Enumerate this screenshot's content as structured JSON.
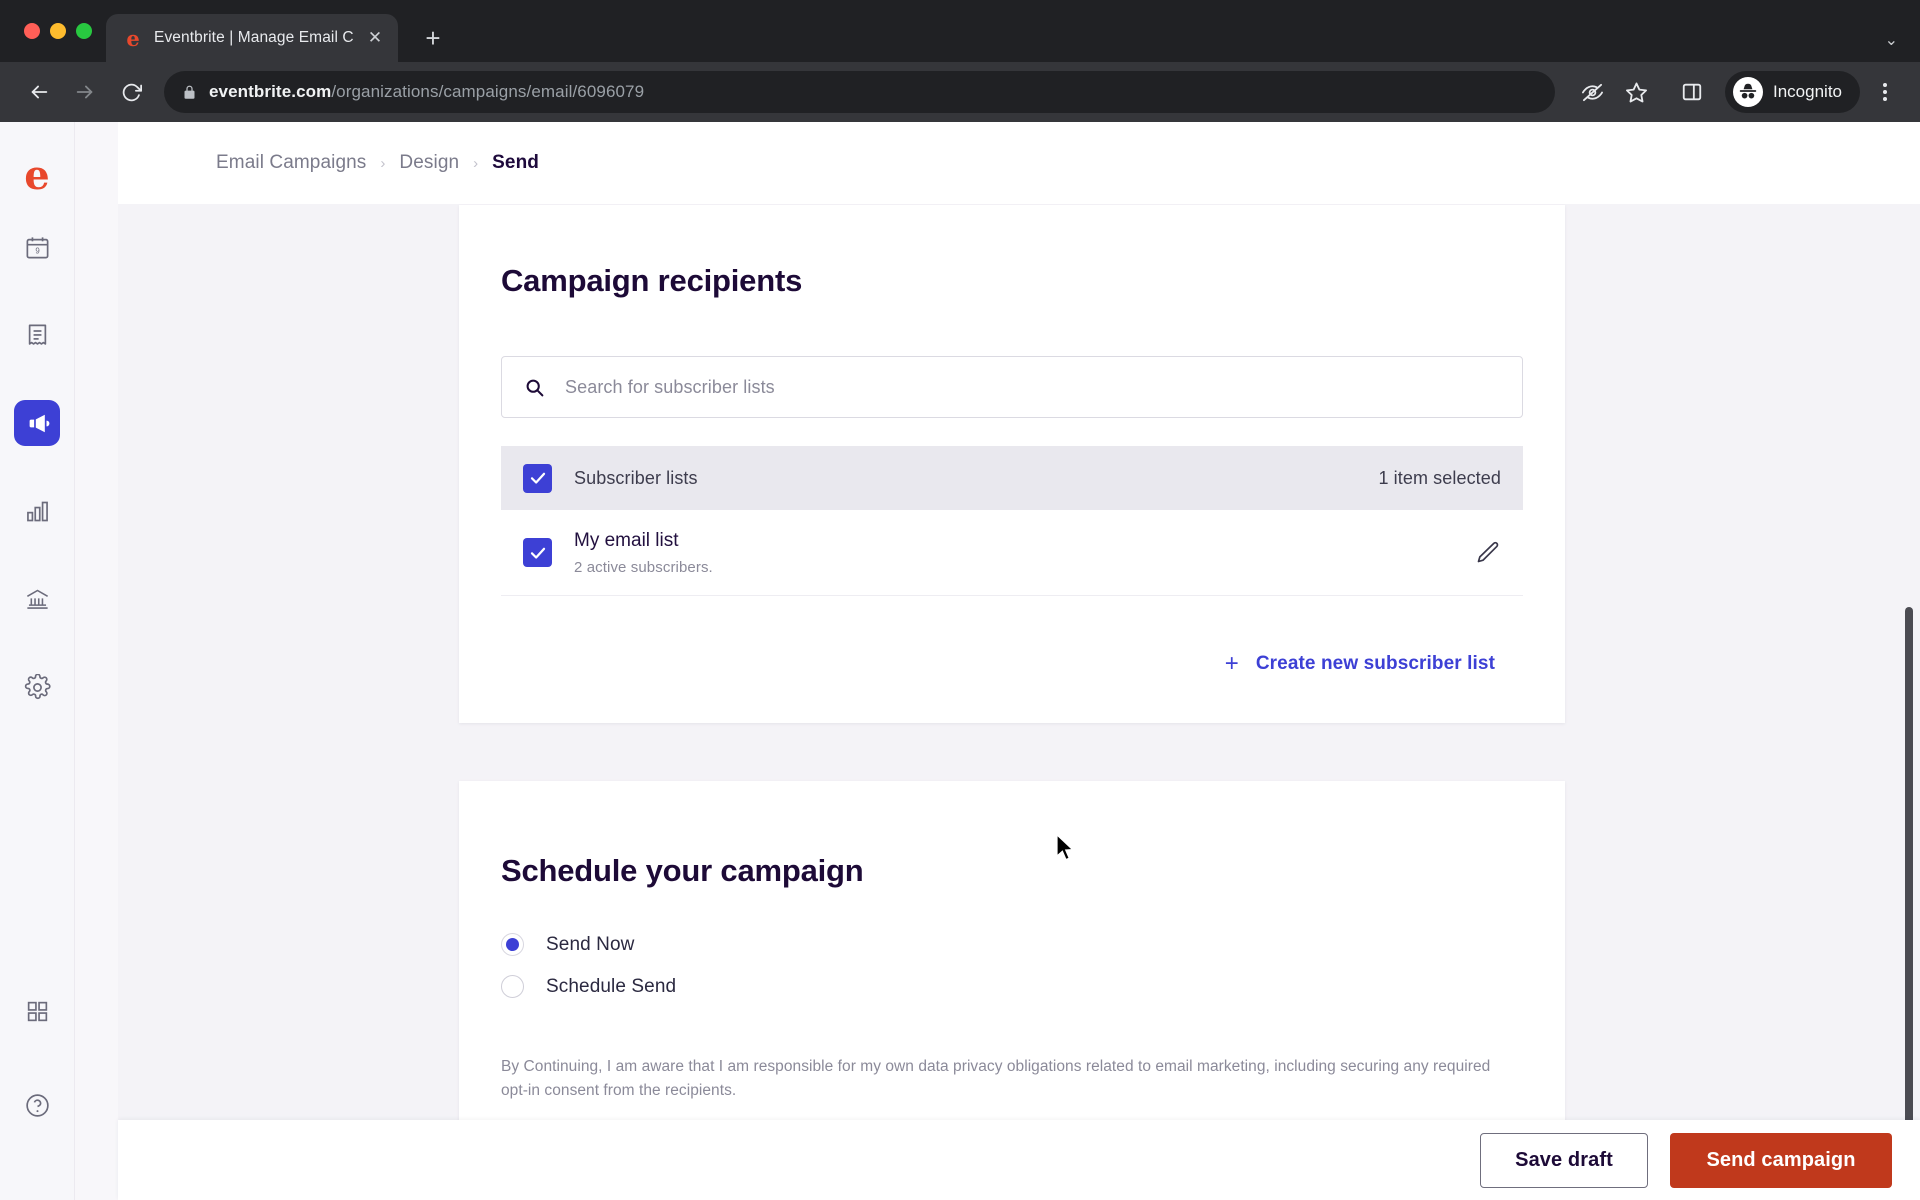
{
  "browser": {
    "tab": {
      "title": "Eventbrite | Manage Email Cam",
      "favicon_letter": "e",
      "close_label": "✕"
    },
    "new_tab_label": "+",
    "tabstrip_overflow_label": "⌄",
    "address": {
      "domain": "eventbrite.com",
      "path": "/organizations/campaigns/email/6096079",
      "lock_icon": "lock-icon"
    },
    "profile": {
      "label": "Incognito"
    },
    "toolbar_icons": [
      "back-icon",
      "forward-icon",
      "reload-icon",
      "tracking-protection-icon",
      "bookmark-star-icon",
      "side-panel-icon",
      "menu-kebab-icon"
    ]
  },
  "rail": {
    "logo_letter": "e",
    "items": [
      {
        "name": "events",
        "icon": "calendar-icon",
        "active": false
      },
      {
        "name": "orders",
        "icon": "receipt-icon",
        "active": false
      },
      {
        "name": "marketing",
        "icon": "megaphone-icon",
        "active": true
      },
      {
        "name": "reports",
        "icon": "bar-chart-icon",
        "active": false
      },
      {
        "name": "finance",
        "icon": "bank-icon",
        "active": false
      },
      {
        "name": "settings",
        "icon": "gear-icon",
        "active": false
      }
    ],
    "bottom_items": [
      {
        "name": "apps",
        "icon": "grid-apps-icon"
      },
      {
        "name": "help",
        "icon": "help-circle-icon"
      }
    ]
  },
  "breadcrumb": {
    "items": [
      "Email Campaigns",
      "Design",
      "Send"
    ],
    "separator": "›",
    "current_index": 2
  },
  "recipients": {
    "title": "Campaign recipients",
    "search": {
      "placeholder": "Search for subscriber lists",
      "value": "",
      "icon": "search-icon"
    },
    "list_header": {
      "label": "Subscriber lists",
      "count_text": "1 item selected",
      "checked": true
    },
    "rows": [
      {
        "title": "My email list",
        "subtitle": "2 active subscribers.",
        "checked": true,
        "action_icon": "pencil-edit-icon"
      }
    ],
    "create_button": {
      "label": "Create new subscriber list",
      "plus": "+"
    }
  },
  "schedule": {
    "title": "Schedule your campaign",
    "options": [
      {
        "label": "Send Now",
        "selected": true
      },
      {
        "label": "Schedule Send",
        "selected": false
      }
    ],
    "disclaimer": "By Continuing, I am aware that I am responsible for my own data privacy obligations related to email marketing, including securing any required opt-in consent from the recipients."
  },
  "actions": {
    "save_draft": "Save draft",
    "send_campaign": "Send campaign"
  },
  "colors": {
    "brand_red": "#e8482c",
    "primary_button": "#c0391c",
    "accent_blue": "#3d40d5",
    "heading": "#1d0a37"
  }
}
